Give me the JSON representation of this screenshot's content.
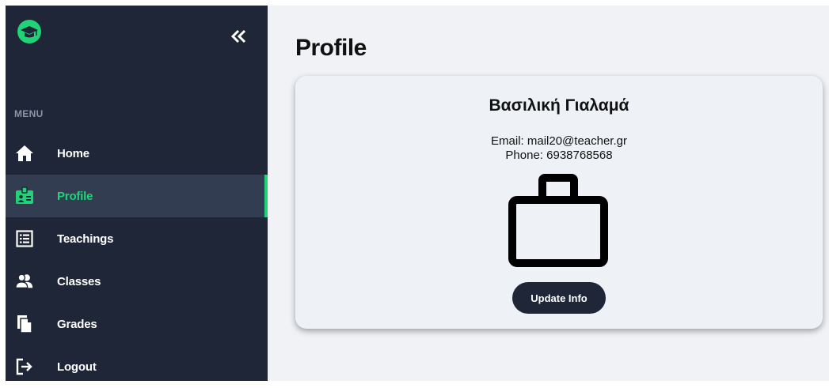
{
  "sidebar": {
    "menu_label": "MENU",
    "collapse_icon": "double-chevron-left-icon",
    "items": [
      {
        "label": "Home",
        "icon": "home-icon",
        "active": false
      },
      {
        "label": "Profile",
        "icon": "id-badge-icon",
        "active": true
      },
      {
        "label": "Teachings",
        "icon": "list-box-icon",
        "active": false
      },
      {
        "label": "Classes",
        "icon": "users-icon",
        "active": false
      },
      {
        "label": "Grades",
        "icon": "documents-icon",
        "active": false
      },
      {
        "label": "Logout",
        "icon": "logout-icon",
        "active": false
      }
    ]
  },
  "main": {
    "title": "Profile",
    "profile": {
      "name": "Βασιλική Γιαλαμά",
      "email_line": "Email: mail20@teacher.gr",
      "phone_line": "Phone: 6938768568",
      "icon": "briefcase-icon",
      "update_button": "Update Info"
    }
  },
  "colors": {
    "sidebar_bg": "#1e2638",
    "active_item_bg": "#323d52",
    "accent": "#20d376",
    "content_bg": "#f0f2f6",
    "button_bg": "#1e2638"
  }
}
